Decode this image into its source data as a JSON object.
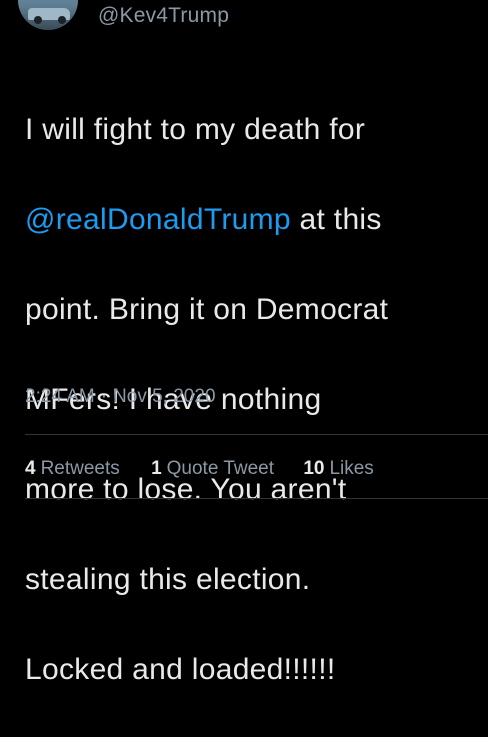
{
  "author": {
    "handle": "@Kev4Trump"
  },
  "tweet": {
    "lines": [
      {
        "before": "I will fight to my death for",
        "mention": "",
        "after": ""
      },
      {
        "before": "",
        "mention": "@realDonaldTrump",
        "after": " at this"
      },
      {
        "before": "point.  Bring it on Democrat",
        "mention": "",
        "after": ""
      },
      {
        "before": "MFers!  I have nothing",
        "mention": "",
        "after": ""
      },
      {
        "before": "more to lose. You aren't",
        "mention": "",
        "after": ""
      },
      {
        "before": "stealing this election.",
        "mention": "",
        "after": ""
      },
      {
        "before": "Locked and loaded!!!!!!",
        "mention": "",
        "after": ""
      }
    ],
    "time": "2:24 AM",
    "separator": "·",
    "date": "Nov 5, 2020"
  },
  "stats": {
    "retweets_count": "4",
    "retweets_label": "Retweets",
    "quotes_count": "1",
    "quotes_label": "Quote Tweet",
    "likes_count": "10",
    "likes_label": "Likes"
  },
  "colors": {
    "background": "#000000",
    "text": "#e7e9ea",
    "secondary": "#8b98a5",
    "link": "#1d9bf0"
  },
  "icons": {
    "avatar": "profile-photo"
  }
}
